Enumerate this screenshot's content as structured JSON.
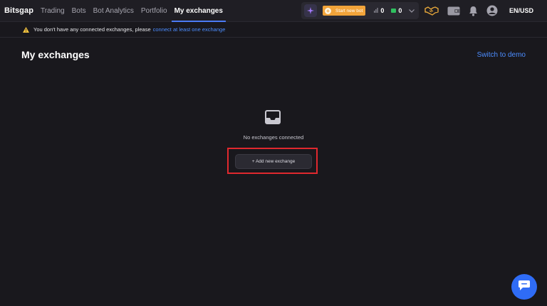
{
  "brand": "Bitsgap",
  "nav": {
    "items": [
      {
        "label": "Trading"
      },
      {
        "label": "Bots"
      },
      {
        "label": "Bot Analytics"
      },
      {
        "label": "Portfolio"
      },
      {
        "label": "My exchanges",
        "active": true
      }
    ]
  },
  "header": {
    "start_bot_label": "Start new bot",
    "bots_count": "0",
    "active_count": "0",
    "locale": "EN/USD",
    "icons": [
      "sparkle-icon",
      "plus-circle-icon",
      "bar-chart-icon",
      "green-square-icon",
      "chevron-down-icon",
      "handshake-icon",
      "wallet-icon",
      "bell-icon",
      "user-avatar-icon"
    ]
  },
  "notice": {
    "text": "You don't have any connected exchanges, please",
    "link": "connect at least one exchange"
  },
  "main": {
    "title": "My exchanges",
    "switch_demo": "Switch to demo",
    "empty_text": "No exchanges connected",
    "add_button": "+ Add new exchange"
  },
  "colors": {
    "background": "#19181d",
    "accent_blue": "#4c8dff",
    "start_bot_orange": "#f2a43a",
    "highlight_red": "#e0282e",
    "chat_blue": "#2f6cf6"
  }
}
